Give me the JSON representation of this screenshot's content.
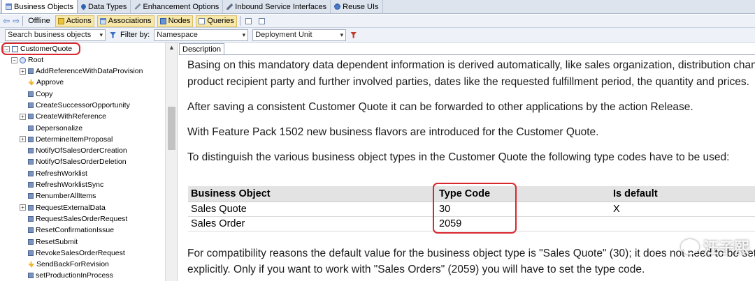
{
  "tabs": [
    {
      "label": "Business Objects",
      "icon": "business-object-icon",
      "active": true
    },
    {
      "label": "Data Types",
      "icon": "data-type-icon"
    },
    {
      "label": "Enhancement Options",
      "icon": "enhancement-icon"
    },
    {
      "label": "Inbound Service Interfaces",
      "icon": "service-interface-icon"
    },
    {
      "label": "Reuse UIs",
      "icon": "reuse-ui-icon"
    }
  ],
  "toolbar": {
    "offline": "Offline",
    "actions": "Actions",
    "associations": "Associations",
    "nodes": "Nodes",
    "queries": "Queries"
  },
  "search": {
    "placeholder": "Search business objects",
    "filter_label": "Filter by:",
    "namespace": "Namespace",
    "deployment_unit": "Deployment Unit"
  },
  "tree": {
    "business_object": "CustomerQuote",
    "root": "Root",
    "items": [
      {
        "label": "AddReferenceWithDataProvision",
        "expandable": true,
        "icon": "operation-icon"
      },
      {
        "label": "Approve",
        "expandable": false,
        "icon": "approve-icon"
      },
      {
        "label": "Copy",
        "expandable": false,
        "icon": "operation-icon"
      },
      {
        "label": "CreateSuccessorOpportunity",
        "expandable": false,
        "icon": "operation-icon"
      },
      {
        "label": "CreateWithReference",
        "expandable": true,
        "icon": "operation-icon"
      },
      {
        "label": "Depersonalize",
        "expandable": false,
        "icon": "operation-icon"
      },
      {
        "label": "DetermineItemProposal",
        "expandable": true,
        "icon": "operation-icon"
      },
      {
        "label": "NotifyOfSalesOrderCreation",
        "expandable": false,
        "icon": "operation-icon"
      },
      {
        "label": "NotifyOfSalesOrderDeletion",
        "expandable": false,
        "icon": "operation-icon"
      },
      {
        "label": "RefreshWorklist",
        "expandable": false,
        "icon": "operation-icon"
      },
      {
        "label": "RefreshWorklistSync",
        "expandable": false,
        "icon": "operation-icon"
      },
      {
        "label": "RenumberAllItems",
        "expandable": false,
        "icon": "operation-icon"
      },
      {
        "label": "RequestExternalData",
        "expandable": true,
        "icon": "operation-icon"
      },
      {
        "label": "RequestSalesOrderRequest",
        "expandable": false,
        "icon": "operation-icon"
      },
      {
        "label": "ResetConfirmationIssue",
        "expandable": false,
        "icon": "operation-icon"
      },
      {
        "label": "ResetSubmit",
        "expandable": false,
        "icon": "operation-icon"
      },
      {
        "label": "RevokeSalesOrderRequest",
        "expandable": false,
        "icon": "operation-icon"
      },
      {
        "label": "SendBackForRevision",
        "expandable": false,
        "icon": "approve-icon"
      },
      {
        "label": "setProductionInProcess",
        "expandable": false,
        "icon": "operation-icon"
      }
    ]
  },
  "description": {
    "tab_label": "Description",
    "para1_line1": "Basing on this mandatory data dependent information is derived automatically, like sales organization, distribution channel,",
    "para1_line2": "product recipient party and further involved parties, dates like the requested fulfillment period, the quantity and prices.",
    "para2": "After saving a consistent Customer Quote it can be forwarded to other applications by the action Release.",
    "para3": "With Feature Pack 1502 new business flavors are introduced for the Customer Quote.",
    "para4": "To distinguish the various business object types in the Customer Quote the following type codes have to be used:",
    "table": {
      "headers": [
        "Business Object",
        "Type Code",
        "Is default"
      ],
      "rows": [
        [
          "Sales Quote",
          "30",
          "X"
        ],
        [
          "Sales Order",
          "2059",
          ""
        ]
      ]
    },
    "para5_line1": "For compatibility reasons the default value for the business object type is \"Sales Quote\" (30); it does not need to be set",
    "para5_line2": "explicitly. Only if you want to work with \"Sales Orders\" (2059) you will have to set the type code."
  },
  "watermark": "汪子熙"
}
